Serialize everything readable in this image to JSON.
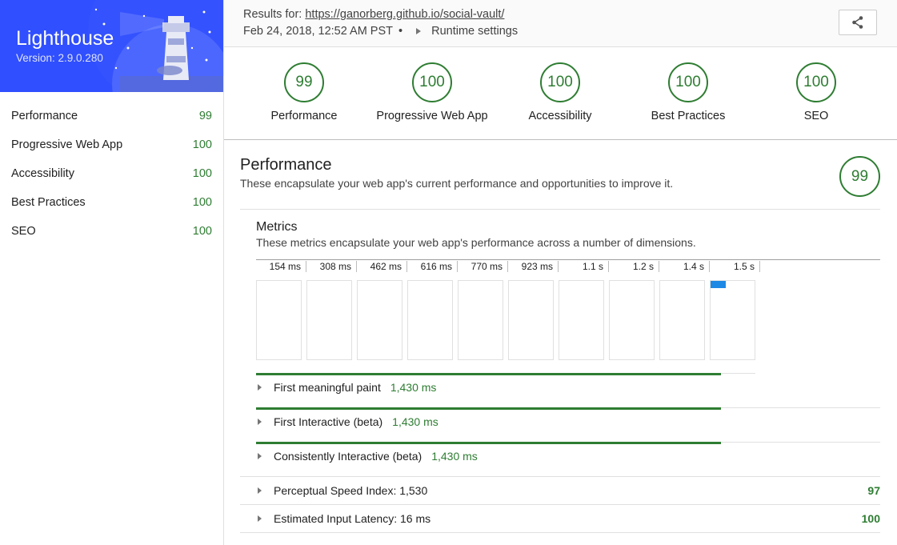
{
  "brand": {
    "title": "Lighthouse",
    "version": "Version: 2.9.0.280"
  },
  "sidebar": {
    "items": [
      {
        "label": "Performance",
        "score": "99"
      },
      {
        "label": "Progressive Web App",
        "score": "100"
      },
      {
        "label": "Accessibility",
        "score": "100"
      },
      {
        "label": "Best Practices",
        "score": "100"
      },
      {
        "label": "SEO",
        "score": "100"
      }
    ]
  },
  "header": {
    "results_prefix": "Results for: ",
    "url": "https://ganorberg.github.io/social-vault/",
    "date": "Feb 24, 2018, 12:52 AM PST",
    "dot": "•",
    "runtime_settings": "Runtime settings"
  },
  "scores": [
    {
      "score": "99",
      "label": "Performance"
    },
    {
      "score": "100",
      "label": "Progressive Web App"
    },
    {
      "score": "100",
      "label": "Accessibility"
    },
    {
      "score": "100",
      "label": "Best Practices"
    },
    {
      "score": "100",
      "label": "SEO"
    }
  ],
  "performance": {
    "title": "Performance",
    "description": "These encapsulate your web app's current performance and opportunities to improve it.",
    "score": "99",
    "metrics_title": "Metrics",
    "metrics_description": "These metrics encapsulate your web app's performance across a number of dimensions.",
    "timeline_ticks": [
      "154 ms",
      "308 ms",
      "462 ms",
      "616 ms",
      "770 ms",
      "923 ms",
      "1.1 s",
      "1.2 s",
      "1.4 s",
      "1.5 s"
    ],
    "metrics": [
      {
        "label": "First meaningful paint",
        "value": "1,430 ms"
      },
      {
        "label": "First Interactive (beta)",
        "value": "1,430 ms"
      },
      {
        "label": "Consistently Interactive (beta)",
        "value": "1,430 ms"
      }
    ],
    "audits": [
      {
        "label": "Perceptual Speed Index: 1,530",
        "score": "97"
      },
      {
        "label": "Estimated Input Latency: 16 ms",
        "score": "100"
      }
    ]
  },
  "colors": {
    "brand": "#304ffe",
    "pass": "#2e7d32",
    "frame_mark": "#1e88e5"
  }
}
